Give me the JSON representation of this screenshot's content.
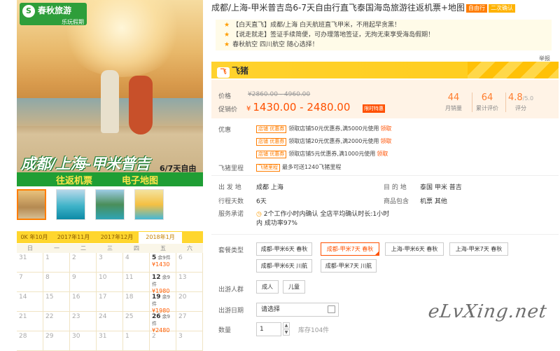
{
  "brand": {
    "logo_main": "春秋旅游",
    "logo_sub": "乐玩假期",
    "logo_symbol": "S"
  },
  "banner": {
    "title": "成都/上海-甲米普吉",
    "subtitle": "6/7天自由行",
    "bar_left": "往返机票",
    "bar_right": "电子地图"
  },
  "thumbnails": [
    "beach-couple",
    "lagoon",
    "island-bay",
    "jiami-poster"
  ],
  "calendar": {
    "months": [
      "0K 年10月",
      "2017年11月",
      "2017年12月",
      "2018年1月"
    ],
    "active_month_index": 3,
    "weekdays": [
      "日",
      "一",
      "二",
      "三",
      "四",
      "五",
      "六"
    ],
    "rows": [
      [
        {
          "d": "31"
        },
        {
          "d": "1"
        },
        {
          "d": "2"
        },
        {
          "d": "3"
        },
        {
          "d": "4"
        },
        {
          "d": "5",
          "rem": "余9件",
          "price": "¥1430"
        },
        {
          "d": "6"
        }
      ],
      [
        {
          "d": "7"
        },
        {
          "d": "8"
        },
        {
          "d": "9"
        },
        {
          "d": "10"
        },
        {
          "d": "11"
        },
        {
          "d": "12",
          "rem": "余9件",
          "price": "¥1980"
        },
        {
          "d": "13"
        }
      ],
      [
        {
          "d": "14"
        },
        {
          "d": "15"
        },
        {
          "d": "16"
        },
        {
          "d": "17"
        },
        {
          "d": "18"
        },
        {
          "d": "19",
          "rem": "余9件",
          "price": "¥1980"
        },
        {
          "d": "20"
        }
      ],
      [
        {
          "d": "21"
        },
        {
          "d": "22"
        },
        {
          "d": "23"
        },
        {
          "d": "24"
        },
        {
          "d": "25"
        },
        {
          "d": "26",
          "rem": "余9件",
          "price": "¥2480"
        },
        {
          "d": "27"
        }
      ],
      [
        {
          "d": "28"
        },
        {
          "d": "29"
        },
        {
          "d": "30"
        },
        {
          "d": "31"
        },
        {
          "d": "1"
        },
        {
          "d": "2"
        },
        {
          "d": "3"
        }
      ]
    ]
  },
  "product": {
    "title": "成都/上海-甲米普吉岛6-7天自由行直飞泰国海岛旅游往返机票+地图",
    "tag1": "自由行",
    "tag2": "二次确认",
    "highlights": [
      {
        "k": "【白天直飞】",
        "v": "成都/上海 白天航班直飞甲米，不用起早贪黑！"
      },
      {
        "k": "【说走就走】",
        "v": "签证手续简便，可办理落地签证，无拘无束享受海岛假期！"
      },
      {
        "k": "",
        "v": "春秋航空 四川航空 随心选择！"
      }
    ],
    "report": "举报"
  },
  "feizhu": {
    "icon": "飞",
    "name": "飞猪"
  },
  "price": {
    "label_price": "价格",
    "original": "¥2860.00 - 4960.00",
    "label_promo": "促销价",
    "currency": "¥",
    "promo": "1430.00 - 2480.00",
    "limited_tag": "限时特惠",
    "stats": [
      {
        "n": "44",
        "unit": "",
        "c": "月销量"
      },
      {
        "n": "64",
        "unit": "",
        "c": "累计评价"
      },
      {
        "n": "4.8",
        "unit": "/5.0",
        "c": "评分"
      }
    ]
  },
  "coupons": {
    "label": "优惠",
    "items": [
      {
        "tag": "店铺 优惠券",
        "text": "领取店铺50元优惠券,满5000元使用",
        "use": "领取"
      },
      {
        "tag": "店铺 优惠券",
        "text": "领取店铺20元优惠券,满2000元使用",
        "use": "领取"
      },
      {
        "tag": "店铺 优惠券",
        "text": "领取店铺5元优惠券,满1000元使用",
        "use": "领取"
      }
    ],
    "mileage_label": "飞猪里程",
    "mileage_tag": "飞猪里程",
    "mileage_text": "最多可送1240飞猪里程"
  },
  "details": {
    "depart_label": "出 发 地",
    "depart_value": "成都  上海",
    "dest_label": "目 的 地",
    "dest_value": "泰国  甲米  普吉",
    "days_label": "行程天数",
    "days_value": "6天",
    "include_label": "商品包含",
    "include_value": "机票  其他",
    "service_label": "服务承诺",
    "service_value": "2个工作小时内确认 全店平均确认时长:1小时",
    "service_value2": "内 成功率97%"
  },
  "package": {
    "label": "套餐类型",
    "options": [
      "成都-甲米6天 春秋",
      "成都-甲米7天 春秋",
      "上海-甲米6天 春秋",
      "上海-甲米7天 春秋",
      "成都-甲米6天 川航",
      "成都-甲米7天 川航"
    ],
    "selected_index": 1
  },
  "people": {
    "label": "出游人群",
    "options": [
      "成人",
      "儿童"
    ]
  },
  "date": {
    "label": "出游日期",
    "placeholder": "请选择"
  },
  "quantity": {
    "label": "数量",
    "value": "1",
    "stock": "库存104件"
  },
  "watermark": "eLvXing.net"
}
